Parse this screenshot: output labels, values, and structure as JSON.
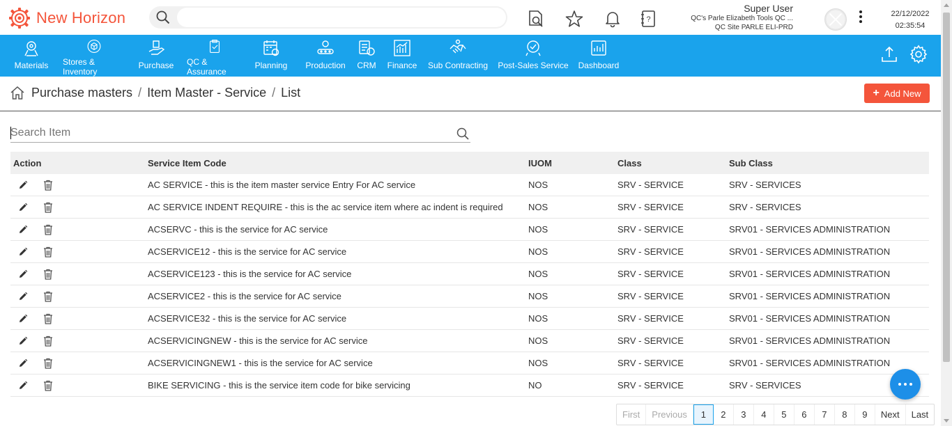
{
  "app": {
    "name": "New Horizon"
  },
  "header": {
    "search_placeholder": "",
    "user": {
      "name": "Super User",
      "company": "QC's Parle Elizabeth Tools QC ...",
      "site": "QC Site PARLE ELI-PRD"
    },
    "date": "22/12/2022",
    "time": "02:35:54"
  },
  "nav": {
    "items": [
      {
        "label": "Materials",
        "icon": "materials-icon"
      },
      {
        "label": "Stores & Inventory",
        "icon": "stores-icon"
      },
      {
        "label": "Purchase",
        "icon": "purchase-icon"
      },
      {
        "label": "QC & Assurance",
        "icon": "qc-icon"
      },
      {
        "label": "Planning",
        "icon": "planning-icon"
      },
      {
        "label": "Production",
        "icon": "production-icon"
      },
      {
        "label": "CRM",
        "icon": "crm-icon"
      },
      {
        "label": "Finance",
        "icon": "finance-icon"
      },
      {
        "label": "Sub Contracting",
        "icon": "subcontracting-icon"
      },
      {
        "label": "Post-Sales Service",
        "icon": "post-sales-icon"
      },
      {
        "label": "Dashboard",
        "icon": "dashboard-icon"
      }
    ]
  },
  "breadcrumb": {
    "items": [
      "Purchase masters",
      "Item Master - Service",
      "List"
    ],
    "separator": "/"
  },
  "actions": {
    "add_new": "Add New"
  },
  "item_search": {
    "placeholder": "Search Item"
  },
  "table": {
    "headers": {
      "action": "Action",
      "code": "Service Item Code",
      "iuom": "IUOM",
      "class": "Class",
      "sub_class": "Sub Class"
    },
    "rows": [
      {
        "code": "AC SERVICE - this is the item master service Entry For AC service",
        "iuom": "NOS",
        "class": "SRV - SERVICE",
        "sub_class": "SRV - SERVICES"
      },
      {
        "code": "AC SERVICE INDENT REQUIRE - this is the ac service item where ac indent is required",
        "iuom": "NOS",
        "class": "SRV - SERVICE",
        "sub_class": "SRV - SERVICES"
      },
      {
        "code": "ACSERVC - this is the service for AC service",
        "iuom": "NOS",
        "class": "SRV - SERVICE",
        "sub_class": "SRV01 - SERVICES ADMINISTRATION"
      },
      {
        "code": "ACSERVICE12 - this is the service for AC service",
        "iuom": "NOS",
        "class": "SRV - SERVICE",
        "sub_class": "SRV01 - SERVICES ADMINISTRATION"
      },
      {
        "code": "ACSERVICE123 - this is the service for AC service",
        "iuom": "NOS",
        "class": "SRV - SERVICE",
        "sub_class": "SRV01 - SERVICES ADMINISTRATION"
      },
      {
        "code": "ACSERVICE2 - this is the service for AC service",
        "iuom": "NOS",
        "class": "SRV - SERVICE",
        "sub_class": "SRV01 - SERVICES ADMINISTRATION"
      },
      {
        "code": "ACSERVICE32 - this is the service for AC service",
        "iuom": "NOS",
        "class": "SRV - SERVICE",
        "sub_class": "SRV01 - SERVICES ADMINISTRATION"
      },
      {
        "code": "ACSERVICINGNEW - this is the service for AC service",
        "iuom": "NOS",
        "class": "SRV - SERVICE",
        "sub_class": "SRV01 - SERVICES ADMINISTRATION"
      },
      {
        "code": "ACSERVICINGNEW1 - this is the service for AC service",
        "iuom": "NOS",
        "class": "SRV - SERVICE",
        "sub_class": "SRV01 - SERVICES ADMINISTRATION"
      },
      {
        "code": "BIKE SERVICING - this is the service item code for bike servicing",
        "iuom": "NO",
        "class": "SRV - SERVICE",
        "sub_class": "SRV - SERVICES"
      }
    ]
  },
  "pagination": {
    "first": "First",
    "previous": "Previous",
    "pages": [
      "1",
      "2",
      "3",
      "4",
      "5",
      "6",
      "7",
      "8",
      "9"
    ],
    "current": "1",
    "next": "Next",
    "last": "Last"
  },
  "colors": {
    "brand": "#f4553b",
    "nav_bg": "#1aa3ec",
    "chat": "#1d8fe8"
  }
}
